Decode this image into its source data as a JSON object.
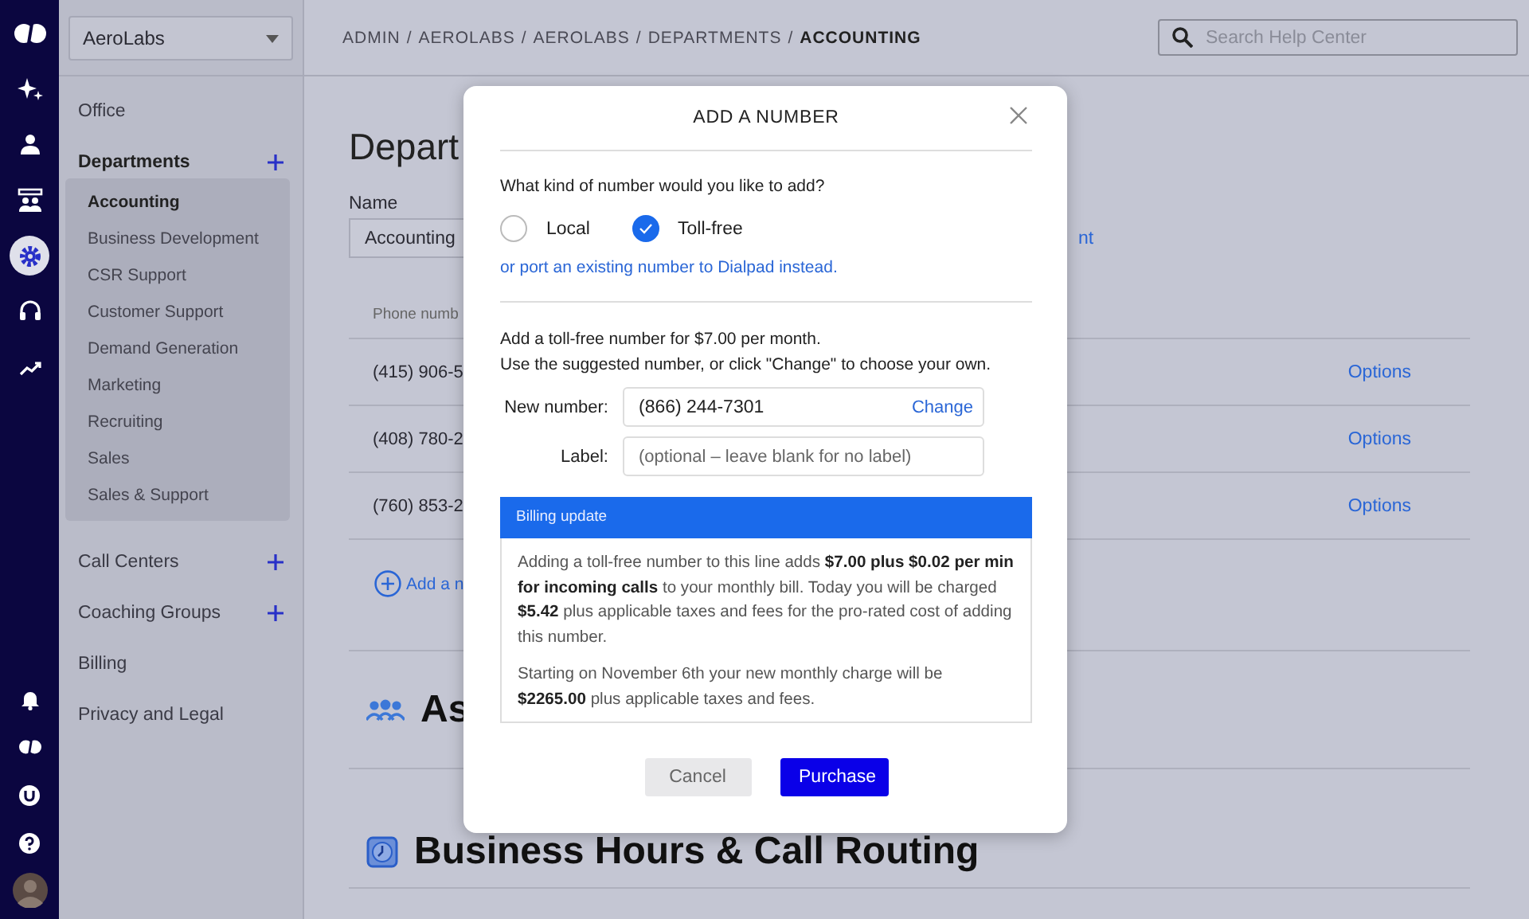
{
  "nav_rail": {
    "top": [
      {
        "kind": "logo",
        "selected": false
      },
      {
        "kind": "sparkles",
        "selected": false
      },
      {
        "kind": "person",
        "selected": false
      },
      {
        "kind": "team",
        "selected": false
      },
      {
        "kind": "gear",
        "selected": true
      },
      {
        "kind": "headset",
        "selected": false
      },
      {
        "kind": "trend",
        "selected": false
      }
    ],
    "bottom": [
      {
        "kind": "bell"
      },
      {
        "kind": "logo"
      },
      {
        "kind": "u-badge"
      },
      {
        "kind": "help"
      },
      {
        "kind": "avatar"
      }
    ]
  },
  "company_select": {
    "value": "AeroLabs"
  },
  "sidebar": {
    "sections": [
      {
        "label": "Office",
        "add": false
      },
      {
        "label": "Departments",
        "add": true,
        "children": [
          {
            "label": "Accounting",
            "selected": true
          },
          {
            "label": "Business Development",
            "selected": false
          },
          {
            "label": "CSR Support",
            "selected": false
          },
          {
            "label": "Customer Support",
            "selected": false
          },
          {
            "label": "Demand Generation",
            "selected": false
          },
          {
            "label": "Marketing",
            "selected": false
          },
          {
            "label": "Recruiting",
            "selected": false
          },
          {
            "label": "Sales",
            "selected": false
          },
          {
            "label": "Sales & Support",
            "selected": false
          }
        ]
      },
      {
        "label": "Call Centers",
        "add": true
      },
      {
        "label": "Coaching Groups",
        "add": true
      },
      {
        "label": "Billing",
        "add": false
      },
      {
        "label": "Privacy and Legal",
        "add": false
      }
    ]
  },
  "breadcrumb": {
    "items": [
      "ADMIN",
      "AEROLABS",
      "AEROLABS",
      "DEPARTMENTS"
    ],
    "separator": "/",
    "current": "ACCOUNTING"
  },
  "search": {
    "placeholder": "Search Help Center"
  },
  "page": {
    "title": "Depart",
    "name_label": "Name",
    "name_value": "Accounting",
    "name_link": "nt",
    "table": {
      "column_1": "Phone numb",
      "rows": [
        {
          "number": "(415) 906-5",
          "action": "Options"
        },
        {
          "number": "(408) 780-2",
          "action": "Options"
        },
        {
          "number": "(760) 853-2",
          "action": "Options"
        }
      ]
    },
    "add_link": "Add a n",
    "sections": [
      {
        "kind": "people",
        "title": "As"
      },
      {
        "kind": "clock",
        "title": "Business Hours & Call Routing"
      }
    ]
  },
  "dialog": {
    "title": "ADD A NUMBER",
    "question": "What kind of number would you like to add?",
    "options": [
      {
        "label": "Local",
        "selected": false
      },
      {
        "label": "Toll-free",
        "selected": true
      }
    ],
    "port_link": "or port an existing number to Dialpad instead.",
    "intro": [
      "Add a toll-free number for $7.00 per month.",
      "Use the suggested number, or click \"Change\" to choose your own."
    ],
    "new_number": {
      "label": "New number:",
      "value": "(866) 244-7301",
      "action": "Change"
    },
    "label_field": {
      "label": "Label:",
      "placeholder": "(optional – leave blank for no label)"
    },
    "billing": {
      "title": "Billing update",
      "paragraphs": [
        "Adding a toll-free number to this line adds **$7.00 plus $0.02 per min for incoming calls** to your monthly bill. Today you will be charged **$5.42** plus applicable taxes and fees for the pro-rated cost of adding this number.",
        "Starting on November 6th your new monthly charge will be **$2265.00** plus applicable taxes and fees."
      ]
    },
    "buttons": [
      {
        "label": "Cancel",
        "kind": "secondary"
      },
      {
        "label": "Purchase",
        "kind": "primary"
      }
    ]
  }
}
